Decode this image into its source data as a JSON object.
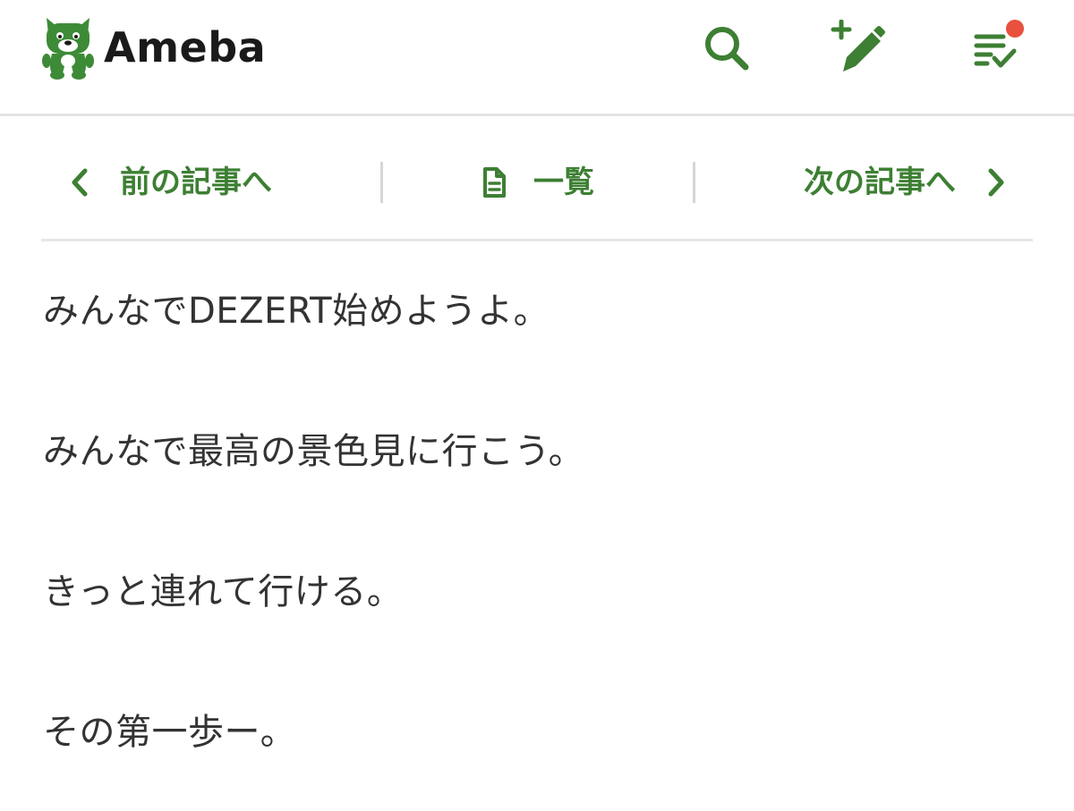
{
  "header": {
    "logo_text": "Ameba",
    "logo_icon": "ameba-dog-icon",
    "search_icon": "search-icon",
    "write_icon": "write-post-icon",
    "feed_icon": "reading-list-icon",
    "has_notification": true
  },
  "nav": {
    "prev_label": "前の記事へ",
    "list_label": "一覧",
    "next_label": "次の記事へ"
  },
  "body": {
    "paragraphs": [
      "みんなでDEZERT始めようよ。",
      "みんなで最高の景色見に行こう。",
      "きっと連れて行ける。",
      "その第一歩ー。"
    ]
  },
  "colors": {
    "brand_green": "#3d7f33",
    "notification_red": "#e8513d",
    "text": "#333333",
    "divider": "#e3e3e3"
  }
}
